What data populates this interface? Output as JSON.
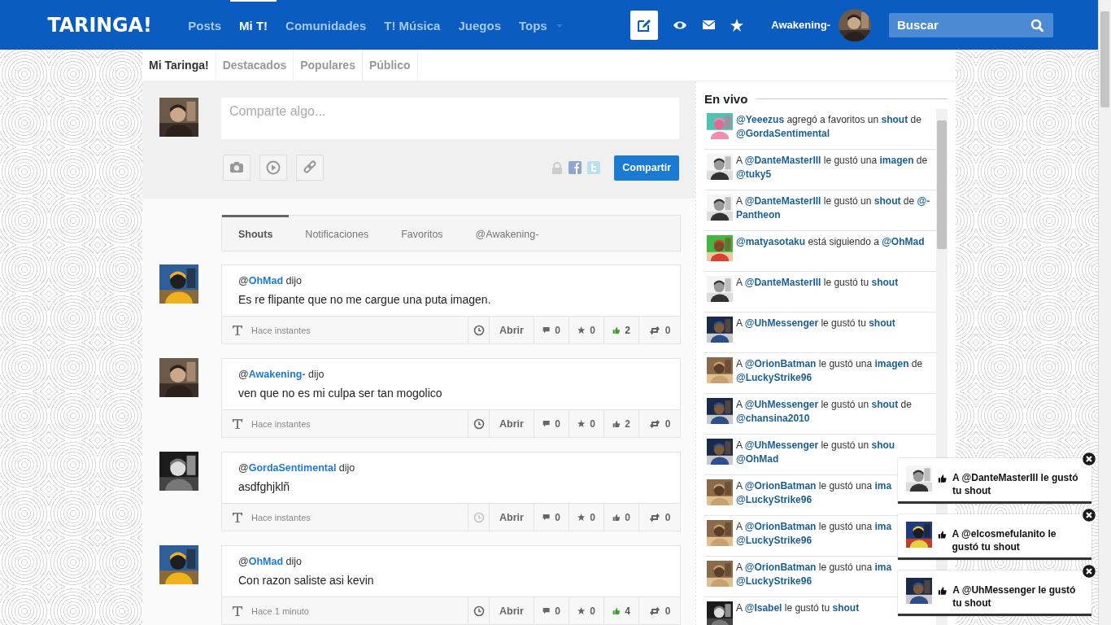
{
  "header": {
    "logo": "TARINGA!",
    "nav": [
      {
        "label": "Posts",
        "selected": false
      },
      {
        "label": "Mi T!",
        "selected": true
      },
      {
        "label": "Comunidades",
        "selected": false
      },
      {
        "label": "T! Música",
        "selected": false
      },
      {
        "label": "Juegos",
        "selected": false
      },
      {
        "label": "Tops",
        "selected": false
      }
    ],
    "username": "Awakening-",
    "search": {
      "placeholder": "Buscar"
    }
  },
  "subnav": [
    {
      "label": "Mi Taringa!",
      "selected": true
    },
    {
      "label": "Destacados",
      "selected": false
    },
    {
      "label": "Populares",
      "selected": false
    },
    {
      "label": "Público",
      "selected": false
    }
  ],
  "composer": {
    "placeholder": "Comparte algo...",
    "button": "Compartir"
  },
  "feed_tabs": [
    {
      "label": "Shouts",
      "selected": true
    },
    {
      "label": "Notificaciones",
      "selected": false
    },
    {
      "label": "Favoritos",
      "selected": false
    },
    {
      "label": "@Awakening-",
      "selected": false
    }
  ],
  "shouts": [
    {
      "header": "@**OhMad** dijo",
      "text": "Es re flipante que no me cargue una puta imagen.",
      "time": "Hace instantes",
      "clock_faded": false,
      "open": "Abrir",
      "comments": "0",
      "favorites": "0",
      "likes": "2",
      "liked": true,
      "shares": "0"
    },
    {
      "header": "@**Awakening-** dijo",
      "text": "ven que no es mi culpa ser tan mogolico",
      "time": "Hace instantes",
      "clock_faded": false,
      "open": "Abrir",
      "comments": "0",
      "favorites": "0",
      "likes": "2",
      "liked": false,
      "shares": "0"
    },
    {
      "header": "@**GordaSentimental** dijo",
      "text": "asdfghjklñ",
      "time": "Hace instantes",
      "clock_faded": true,
      "open": "Abrir",
      "comments": "0",
      "favorites": "0",
      "likes": "0",
      "liked": false,
      "shares": "0"
    },
    {
      "header": "@**OhMad** dijo",
      "text": "Con razon saliste asi kevin",
      "time": "Hace 1 minuto",
      "clock_faded": false,
      "open": "Abrir",
      "comments": "0",
      "favorites": "0",
      "likes": "4",
      "liked": true,
      "shares": "0"
    }
  ],
  "live": {
    "title": "En vivo",
    "items": [
      {
        "lines": [
          "**@Yeeezus** agregó a favoritos un **shout** de",
          "**@GordaSentimental**"
        ]
      },
      {
        "lines": [
          "A **@DanteMasterIII** le gustó una **imagen** de",
          "**@tuky5**"
        ]
      },
      {
        "lines": [
          "A **@DanteMasterIII** le gustó un **shout** de **@-**",
          "**Pantheon**"
        ]
      },
      {
        "lines": [
          "**@matyasotaku** está siguiendo a **@OhMad**"
        ]
      },
      {
        "lines": [
          "A **@DanteMasterIII** le gustó tu **shout**"
        ]
      },
      {
        "lines": [
          "A **@UhMessenger** le gustó tu **shout**"
        ]
      },
      {
        "lines": [
          "A **@OrionBatman** le gustó una **imagen** de",
          "**@LuckyStrike96**"
        ]
      },
      {
        "lines": [
          "A **@UhMessenger** le gustó un **shout** de",
          "**@chansina2010**"
        ]
      },
      {
        "lines": [
          "A **@UhMessenger** le gustó un **shou**",
          "**@OhMad**"
        ]
      },
      {
        "lines": [
          "A **@OrionBatman** le gustó una **ima**",
          "**@LuckyStrike96**"
        ]
      },
      {
        "lines": [
          "A **@OrionBatman** le gustó una **ima**",
          "**@LuckyStrike96**"
        ]
      },
      {
        "lines": [
          "A **@OrionBatman** le gustó una **ima**",
          "**@LuckyStrike96**"
        ]
      },
      {
        "lines": [
          "A **@Isabel** le gustó tu **shout**"
        ]
      }
    ]
  },
  "toasts": [
    {
      "text": "A @DanteMasterIII le gustó tu shout"
    },
    {
      "text": "A @elcosmefulanito le gustó tu shout"
    },
    {
      "text": "A @UhMessenger le gustó tu shout"
    }
  ]
}
